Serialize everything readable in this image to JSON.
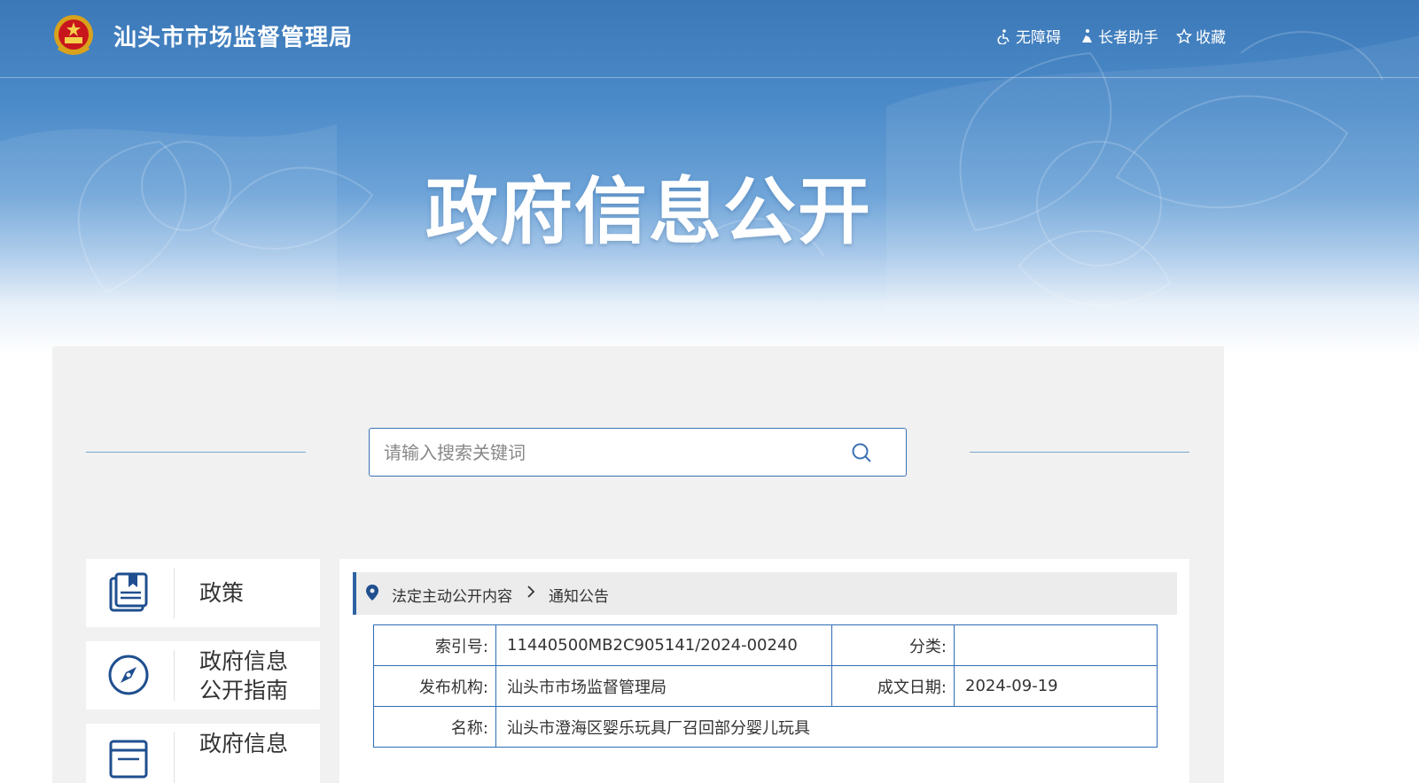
{
  "header": {
    "site_title": "汕头市市场监督管理局",
    "banner_title": "政府信息公开",
    "tools": [
      {
        "label": "无障碍",
        "icon": "accessibility-icon"
      },
      {
        "label": "长者助手",
        "icon": "elder-assistant-icon"
      },
      {
        "label": "收藏",
        "icon": "star-icon"
      }
    ]
  },
  "search": {
    "placeholder": "请输入搜索关键词",
    "value": ""
  },
  "sidebar": {
    "items": [
      {
        "label": "政策",
        "icon": "book-icon"
      },
      {
        "label": "政府信息公开指南",
        "line1": "政府信息",
        "line2": "公开指南",
        "icon": "compass-icon"
      },
      {
        "label": "政府信息",
        "icon": "document-list-icon"
      }
    ]
  },
  "breadcrumb": {
    "items": [
      "法定主动公开内容",
      "通知公告"
    ]
  },
  "info": {
    "index_label": "索引号:",
    "index_value": "11440500MB2C905141/2024-00240",
    "category_label": "分类:",
    "category_value": "",
    "publisher_label": "发布机构:",
    "publisher_value": "汕头市市场监督管理局",
    "date_label": "成文日期:",
    "date_value": "2024-09-19",
    "name_label": "名称:",
    "name_value": "汕头市澄海区婴乐玩具厂召回部分婴儿玩具"
  },
  "colors": {
    "primary": "#2e62a3",
    "banner_blue": "#4c8bc9",
    "panel_bg": "#f1f1f1"
  }
}
